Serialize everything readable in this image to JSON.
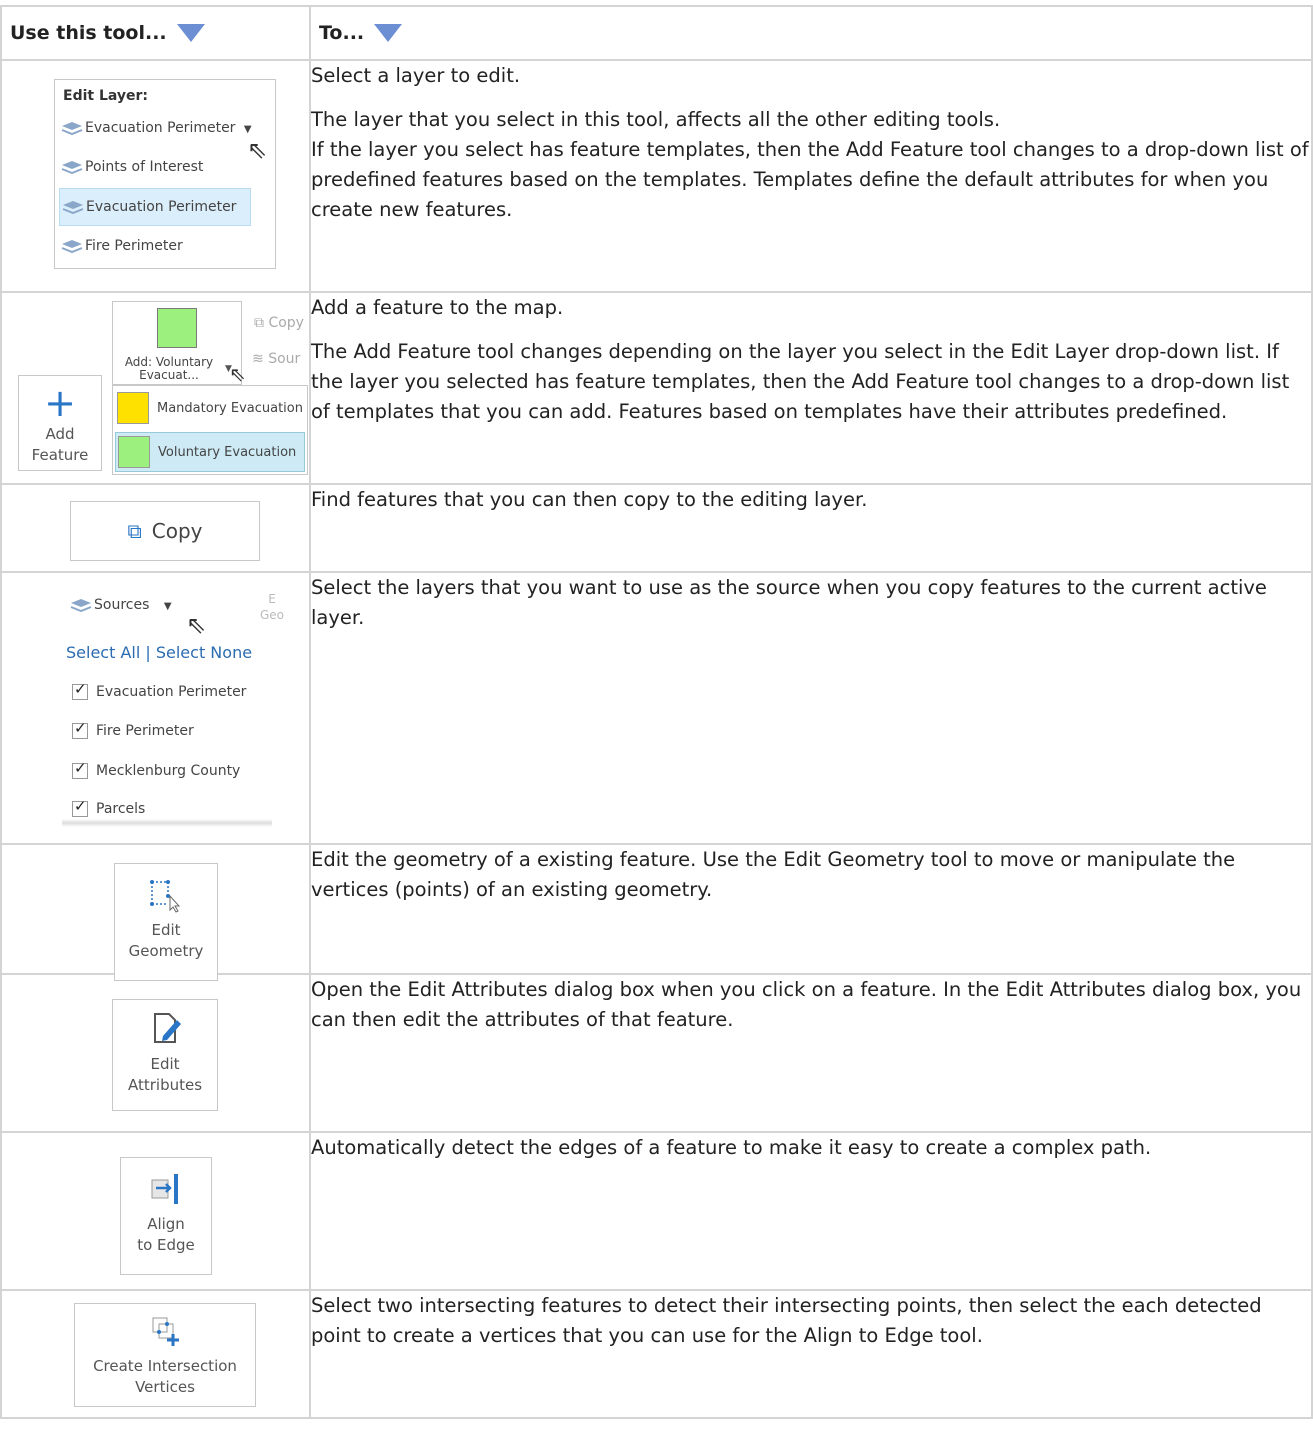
{
  "header": {
    "tool_col": "Use this tool...",
    "desc_col": "To..."
  },
  "rows": [
    {
      "ui": {
        "title": "Edit Layer:",
        "selected": "Evacuation Perimeter",
        "items": [
          "Points of Interest",
          "Evacuation Perimeter",
          "Fire Perimeter"
        ]
      },
      "desc": [
        "Select a layer to edit.",
        "The layer that you select in this tool, affects all the other editing tools.",
        "If the layer you select has feature templates, then the Add Feature tool changes to a drop-down list of predefined features based on the templates. Templates define the default attributes for when you create new features."
      ]
    },
    {
      "ui": {
        "add_label_1": "Add",
        "add_label_2": "Feature",
        "dropdown_1": "Add: Voluntary",
        "dropdown_2": "Evacuat...",
        "copy_cut": "Copy",
        "sources_cut": "Sour",
        "items": [
          "Mandatory Evacuation",
          "Voluntary Evacuation"
        ],
        "colors": [
          "#ffe100",
          "#9cf07e"
        ]
      },
      "desc": [
        "Add a feature to the map.",
        "The Add Feature tool changes depending on the layer you select in the Edit Layer drop-down list. If the layer you selected has feature templates, then the Add Feature tool changes to a drop-down list of templates that you can add. Features based on templates have their attributes predefined."
      ]
    },
    {
      "ui": {
        "label": "Copy"
      },
      "desc": [
        "Find features that you can then copy to the editing layer."
      ]
    },
    {
      "ui": {
        "label": "Sources",
        "cut_1": "E",
        "cut_2": "Geo",
        "select_all": "Select All",
        "sep": "|",
        "select_none": "Select None",
        "items": [
          "Evacuation Perimeter",
          "Fire Perimeter",
          "Mecklenburg County",
          "Parcels"
        ]
      },
      "desc": [
        "Select the layers that you want to use as the source when you copy features to the current active layer."
      ]
    },
    {
      "ui": {
        "label_1": "Edit",
        "label_2": "Geometry"
      },
      "desc": [
        "Edit the geometry of a existing feature. Use the Edit Geometry tool to move or manipulate the vertices (points) of an existing geometry."
      ]
    },
    {
      "ui": {
        "label_1": "Edit",
        "label_2": "Attributes"
      },
      "desc": [
        "Open the Edit Attributes dialog box when you click on a feature. In the Edit Attributes dialog box, you can then edit the attributes of that feature."
      ]
    },
    {
      "ui": {
        "label_1": "Align",
        "label_2": "to Edge"
      },
      "desc": [
        "Automatically detect the edges of a feature to make it easy to create a complex path."
      ]
    },
    {
      "ui": {
        "label_1": "Create Intersection",
        "label_2": "Vertices"
      },
      "desc": [
        "Select two intersecting features to detect their intersecting points, then select the each detected point to create a vertices that you can use for the Align to Edge tool."
      ]
    }
  ]
}
